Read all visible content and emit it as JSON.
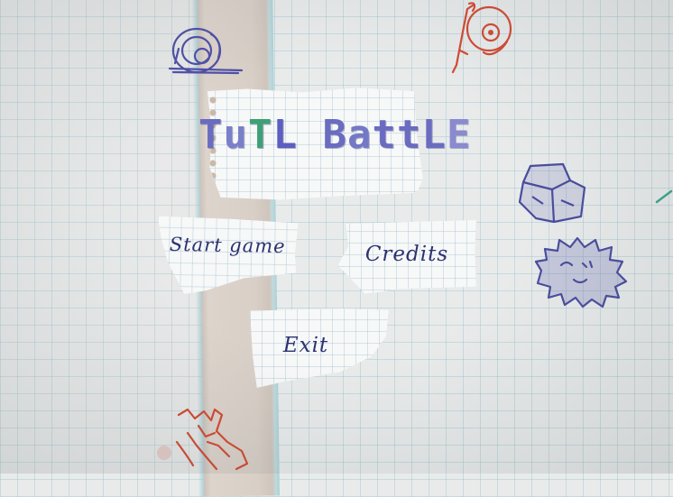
{
  "game": {
    "title": "TuTL BattLE",
    "title_letters": [
      "T",
      "u",
      "T",
      "L",
      " ",
      "B",
      "a",
      "t",
      "t",
      "L",
      "E"
    ],
    "title_letter_colors": [
      "#6a6cc0",
      "#7a80c8",
      "#3fa078",
      "#5b5fbf",
      "#ffffff",
      "#6a6cc0",
      "#7379c4",
      "#6a6cc0",
      "#6a6cc0",
      "#6a6cc0",
      "#8a8ad0"
    ]
  },
  "menu": {
    "start_label": "Start game",
    "credits_label": "Credits",
    "exit_label": "Exit"
  },
  "doodles": [
    {
      "name": "blue-turtle-character-icon",
      "color": "#4f4fa8"
    },
    {
      "name": "red-turtle-character-icon",
      "color": "#d24a32"
    },
    {
      "name": "rock-obstacle-icon",
      "color": "#4a4c9e"
    },
    {
      "name": "spiky-bush-obstacle-icon",
      "color": "#4a4c9e"
    },
    {
      "name": "fallen-turtle-character-icon",
      "color": "#d24a32"
    },
    {
      "name": "green-pencil-mark-icon",
      "color": "#3aa788"
    }
  ],
  "colors": {
    "ink_blue": "#2c3270",
    "ink_title": "#6a6cc0",
    "ink_green": "#3fa078",
    "ink_red": "#d24a32",
    "paper": "#f7f8f8",
    "grid": "#a0c3cd",
    "ruler": "#d8cfc7"
  }
}
